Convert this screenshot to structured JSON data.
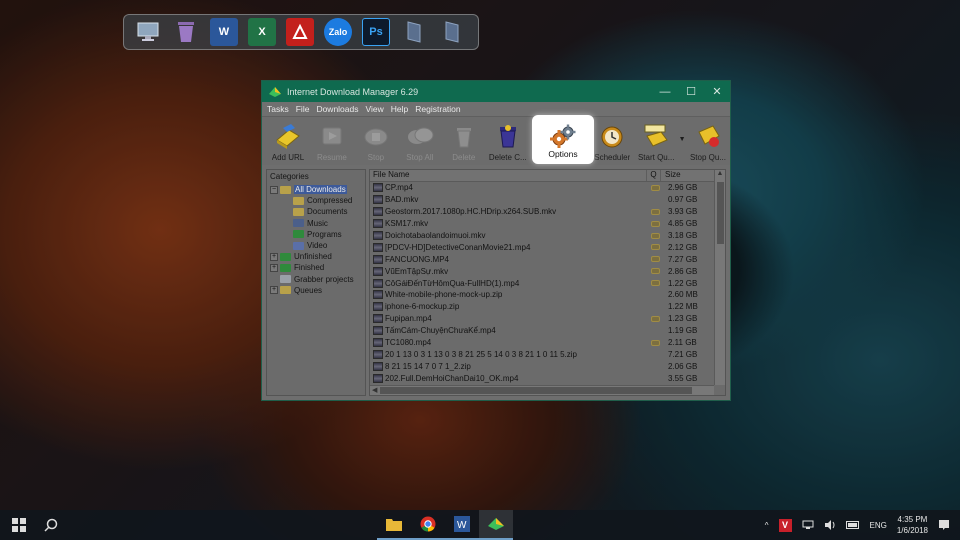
{
  "dock": {
    "icons": [
      "monitor-icon",
      "recycle-bin-icon",
      "word-icon",
      "excel-icon",
      "garena-icon",
      "zalo-icon",
      "photoshop-icon",
      "panel-icon",
      "panel-icon"
    ],
    "word_glyph": "W",
    "excel_glyph": "X",
    "zalo_glyph": "Zalo",
    "ps_glyph": "Ps"
  },
  "window": {
    "title": "Internet Download Manager 6.29",
    "controls": {
      "minimize": "—",
      "maximize": "☐",
      "close": "✕"
    },
    "menu": [
      "Tasks",
      "File",
      "Downloads",
      "View",
      "Help",
      "Registration"
    ],
    "toolbar": [
      {
        "label": "Add URL",
        "enabled": true,
        "icon": "add-url-icon"
      },
      {
        "label": "Resume",
        "enabled": false,
        "icon": "resume-icon"
      },
      {
        "label": "Stop",
        "enabled": false,
        "icon": "stop-icon"
      },
      {
        "label": "Stop All",
        "enabled": false,
        "icon": "stop-all-icon"
      },
      {
        "label": "Delete",
        "enabled": false,
        "icon": "delete-icon"
      },
      {
        "label": "Delete C...",
        "enabled": true,
        "icon": "delete-completed-icon"
      },
      {
        "label": "Options",
        "enabled": true,
        "icon": "options-gear-icon",
        "highlighted": true
      },
      {
        "label": "Scheduler",
        "enabled": true,
        "icon": "scheduler-clock-icon"
      },
      {
        "label": "Start Qu...",
        "enabled": true,
        "icon": "start-queue-icon"
      },
      {
        "label": "Stop Qu...",
        "enabled": true,
        "icon": "stop-queue-icon"
      }
    ],
    "categories": {
      "title": "Categories",
      "items": [
        {
          "label": "All Downloads",
          "level": 0,
          "expander": "−",
          "folder": "open",
          "selected": true
        },
        {
          "label": "Compressed",
          "level": 1,
          "folder": "yellow"
        },
        {
          "label": "Documents",
          "level": 1,
          "folder": "yellow"
        },
        {
          "label": "Music",
          "level": 1,
          "folder": "note"
        },
        {
          "label": "Programs",
          "level": 1,
          "folder": "green"
        },
        {
          "label": "Video",
          "level": 1,
          "folder": "blue"
        },
        {
          "label": "Unfinished",
          "level": 0,
          "expander": "+",
          "folder": "green"
        },
        {
          "label": "Finished",
          "level": 0,
          "expander": "+",
          "folder": "green"
        },
        {
          "label": "Grabber projects",
          "level": 0,
          "folder": "grey"
        },
        {
          "label": "Queues",
          "level": 0,
          "expander": "+",
          "folder": "yellow"
        }
      ]
    },
    "files": {
      "headers": {
        "name": "File Name",
        "q": "Q",
        "size": "Size"
      },
      "rows": [
        {
          "name": "CP.mp4",
          "q": true,
          "size": "2.96  GB"
        },
        {
          "name": "BAD.mkv",
          "q": false,
          "size": "0.97  GB"
        },
        {
          "name": "Geostorm.2017.1080p.HC.HDrip.x264.SUB.mkv",
          "q": true,
          "size": "3.93  GB"
        },
        {
          "name": "KSM17.mkv",
          "q": true,
          "size": "4.85  GB"
        },
        {
          "name": "Doichotabaolandoimuoi.mkv",
          "q": true,
          "size": "3.18  GB"
        },
        {
          "name": "[PDCV-HD]DetectiveConanMovie21.mp4",
          "q": true,
          "size": "2.12  GB"
        },
        {
          "name": "FANCUONG.MP4",
          "q": true,
          "size": "7.27  GB"
        },
        {
          "name": "VũEmTậpSự.mkv",
          "q": true,
          "size": "2.86  GB"
        },
        {
          "name": "CôGáiĐếnTừHômQua-FullHD(1).mp4",
          "q": true,
          "size": "1.22  GB"
        },
        {
          "name": "White-mobile-phone-mock-up.zip",
          "q": false,
          "size": "2.60  MB"
        },
        {
          "name": "iphone-6-mockup.zip",
          "q": false,
          "size": "1.22  MB"
        },
        {
          "name": "Fupipan.mp4",
          "q": true,
          "size": "1.23  GB"
        },
        {
          "name": "TấmCám-ChuyệnChưaKể.mp4",
          "q": false,
          "size": "1.19  GB"
        },
        {
          "name": "TC1080.mp4",
          "q": true,
          "size": "2.11  GB"
        },
        {
          "name": "20 1 13 0 3 1 13 0 3 8 21 25 5 14 0 3 8 21 1 0 11 5.zip",
          "q": false,
          "size": "7.21  GB"
        },
        {
          "name": "8 21 15 14 7 0 7 1_2.zip",
          "q": false,
          "size": "2.06  GB"
        },
        {
          "name": "202.Full.DemHoiChanDai10_OK.mp4",
          "q": false,
          "size": "3.55  GB"
        }
      ]
    }
  },
  "taskbar": {
    "apps": [
      "file-explorer-icon",
      "chrome-icon",
      "word-icon",
      "idm-icon"
    ],
    "tray": {
      "chevron": "^",
      "v_badge": "V",
      "lang": "ENG",
      "time": "4:35 PM",
      "date": "1/6/2018"
    }
  }
}
